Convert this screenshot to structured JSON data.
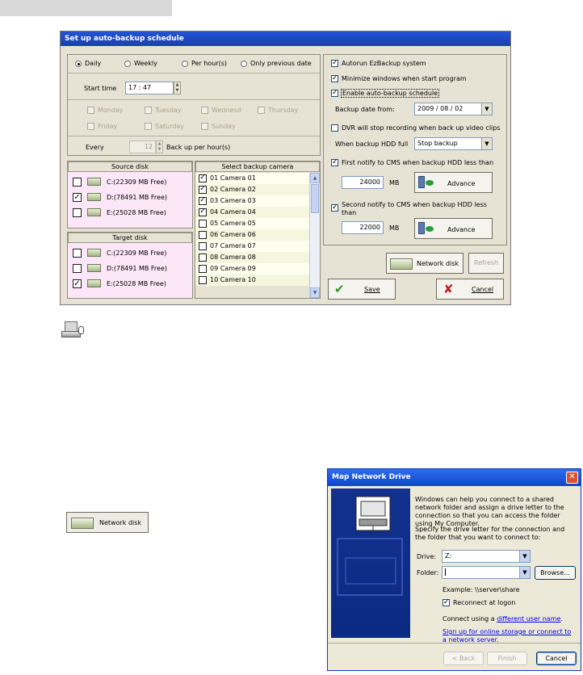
{
  "dialog": {
    "title": "Set up auto-backup schedule",
    "schedule": {
      "modes": [
        {
          "label": "Daily",
          "selected": true
        },
        {
          "label": "Weekly",
          "selected": false
        },
        {
          "label": "Per hour(s)",
          "selected": false
        },
        {
          "label": "Only previous date",
          "selected": false
        }
      ],
      "start_time_label": "Start time",
      "start_time_value": "17 : 47",
      "days": [
        "Monday",
        "Tuesday",
        "Wednesd",
        "Thursday",
        "Friday",
        "Saturday",
        "Sunday"
      ],
      "every_label": "Every",
      "every_value": "12",
      "every_suffix": "Back up per hour(s)"
    },
    "source_disk": {
      "header": "Source disk",
      "items": [
        {
          "label": "C:(22309 MB Free)",
          "checked": false
        },
        {
          "label": "D:(78491 MB Free)",
          "checked": true
        },
        {
          "label": "E:(25028 MB Free)",
          "checked": false
        }
      ]
    },
    "target_disk": {
      "header": "Target disk",
      "items": [
        {
          "label": "C:(22309 MB Free)",
          "checked": false
        },
        {
          "label": "D:(78491 MB Free)",
          "checked": false
        },
        {
          "label": "E:(25028 MB Free)",
          "checked": true
        }
      ]
    },
    "cameras": {
      "header": "Select backup camera",
      "items": [
        {
          "label": "01 Camera 01",
          "checked": true
        },
        {
          "label": "02 Camera 02",
          "checked": true
        },
        {
          "label": "03 Camera 03",
          "checked": true
        },
        {
          "label": "04 Camera 04",
          "checked": true
        },
        {
          "label": "05 Camera 05",
          "checked": false
        },
        {
          "label": "06 Camera 06",
          "checked": false
        },
        {
          "label": "07 Camera 07",
          "checked": false
        },
        {
          "label": "08 Camera 08",
          "checked": false
        },
        {
          "label": "09 Camera 09",
          "checked": false
        },
        {
          "label": "10 Camera 10",
          "checked": false
        }
      ]
    },
    "options": {
      "autorun": {
        "label": "Autorun EzBackup system",
        "checked": true
      },
      "minimize": {
        "label": "Minimize windows when start program",
        "checked": true
      },
      "enable_auto": {
        "label": "Enable auto-backup schedule",
        "checked": true
      },
      "backup_date_label": "Backup date from:",
      "backup_date_value": "2009 / 08 / 02",
      "dvr_stop": {
        "label": "DVR will stop recording when back up video clips",
        "checked": false
      },
      "hdd_full_label": "When backup HDD full",
      "hdd_full_value": "Stop backup",
      "first_notify": {
        "label": "First notify to CMS when backup HDD less than",
        "checked": true
      },
      "first_value": "24000",
      "second_notify": {
        "label": "Second notify to CMS when backup HDD less than",
        "checked": true
      },
      "second_value": "22000",
      "unit": "MB",
      "advance_label": "Advance"
    },
    "buttons": {
      "network_disk": "Network disk",
      "refresh": "Refresh",
      "save": "Save",
      "cancel": "Cancel"
    }
  },
  "standalone": {
    "network_disk_label": "Network disk"
  },
  "map_drive": {
    "title": "Map Network Drive",
    "intro": "Windows can help you connect to a shared network folder and assign a drive letter to the connection so that you can access the folder using My Computer.",
    "specify": "Specify the drive letter for the connection and the folder that you want to connect to:",
    "drive_label": "Drive:",
    "drive_value": "Z:",
    "folder_label": "Folder:",
    "folder_value": "",
    "browse_label": "Browse...",
    "example": "Example: \\\\server\\share",
    "reconnect_label": "Reconnect at logon",
    "reconnect_checked": true,
    "connect_using_prefix": "Connect using a ",
    "connect_using_link": "different user name",
    "connect_using_suffix": ".",
    "signup_link": "Sign up for online storage or connect to a network server.",
    "back_label": "< Back",
    "finish_label": "Finish",
    "cancel_label": "Cancel"
  },
  "colors": {
    "title_blue": "#2454d6",
    "panel_bg": "#e7e3d4",
    "list_pink": "#fbe7f7",
    "xp_blue": "#0b2a82"
  }
}
